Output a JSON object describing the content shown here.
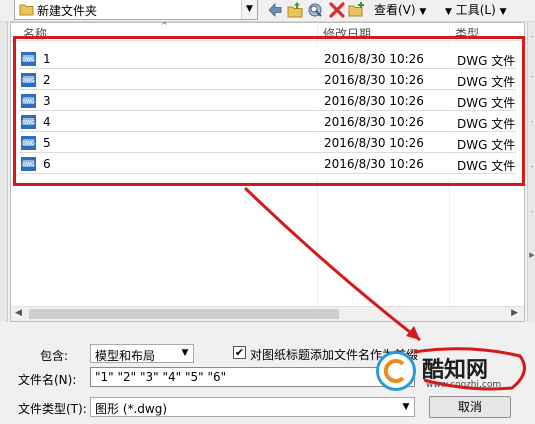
{
  "toolbar": {
    "location": "新建文件夹",
    "view_menu": "查看(V)",
    "tools_menu": "工具(L)"
  },
  "list": {
    "columns": {
      "name": "名称",
      "modified": "修改日期",
      "type": "类型"
    },
    "files": [
      {
        "name": "1",
        "modified": "2016/8/30 10:26",
        "type": "DWG 文件"
      },
      {
        "name": "2",
        "modified": "2016/8/30 10:26",
        "type": "DWG 文件"
      },
      {
        "name": "3",
        "modified": "2016/8/30 10:26",
        "type": "DWG 文件"
      },
      {
        "name": "4",
        "modified": "2016/8/30 10:26",
        "type": "DWG 文件"
      },
      {
        "name": "5",
        "modified": "2016/8/30 10:26",
        "type": "DWG 文件"
      },
      {
        "name": "6",
        "modified": "2016/8/30 10:26",
        "type": "DWG 文件"
      }
    ]
  },
  "form": {
    "include_label": "包含:",
    "include_value": "模型和布局",
    "checkbox_label": "对图纸标题添加文件名作为前缀",
    "checkbox_checked": true,
    "filename_label": "文件名(N):",
    "filename_value": "\"1\" \"2\" \"3\" \"4\" \"5\" \"6\"",
    "filetype_label": "文件类型(T):",
    "filetype_value": "图形 (*.dwg)",
    "cancel_label": "取消"
  },
  "watermark": {
    "title": "酷知网",
    "url": "www.coozhi.com"
  },
  "colors": {
    "highlight": "#d41a1a",
    "file_icon": "#2f6fb8",
    "watermark_blue": "#2b9ad8"
  },
  "icons": [
    "folder-icon",
    "back-arrow-icon",
    "up-folder-icon",
    "search-web-icon",
    "delete-icon",
    "new-folder-icon",
    "dwg-file-icon",
    "checkmark-icon",
    "chevron-down-icon"
  ]
}
